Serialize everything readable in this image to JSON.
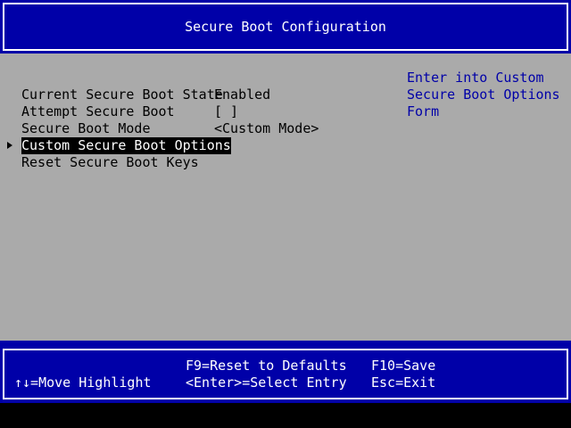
{
  "header": {
    "title": "Secure Boot Configuration"
  },
  "menu": {
    "current_state_label": "Current Secure Boot State",
    "current_state_value": "Enabled",
    "attempt_label": "Attempt Secure Boot",
    "attempt_value": "[ ]",
    "mode_label": "Secure Boot Mode",
    "mode_value": "<Custom Mode>",
    "custom_options_label": "Custom Secure Boot Options",
    "reset_keys_label": "Reset Secure Boot Keys"
  },
  "help": {
    "lines": [
      "Enter into Custom",
      "Secure Boot Options",
      "Form"
    ]
  },
  "footer": {
    "f9": "F9=Reset to Defaults",
    "f10": "F10=Save",
    "move": "↑↓=Move Highlight",
    "enter": "<Enter>=Select Entry",
    "esc": "Esc=Exit"
  },
  "colors": {
    "bar_blue": "#0000a8",
    "body_gray": "#aaaaaa",
    "help_text": "#0000a8",
    "highlight_bg": "#000000",
    "highlight_fg": "#ffffff"
  }
}
